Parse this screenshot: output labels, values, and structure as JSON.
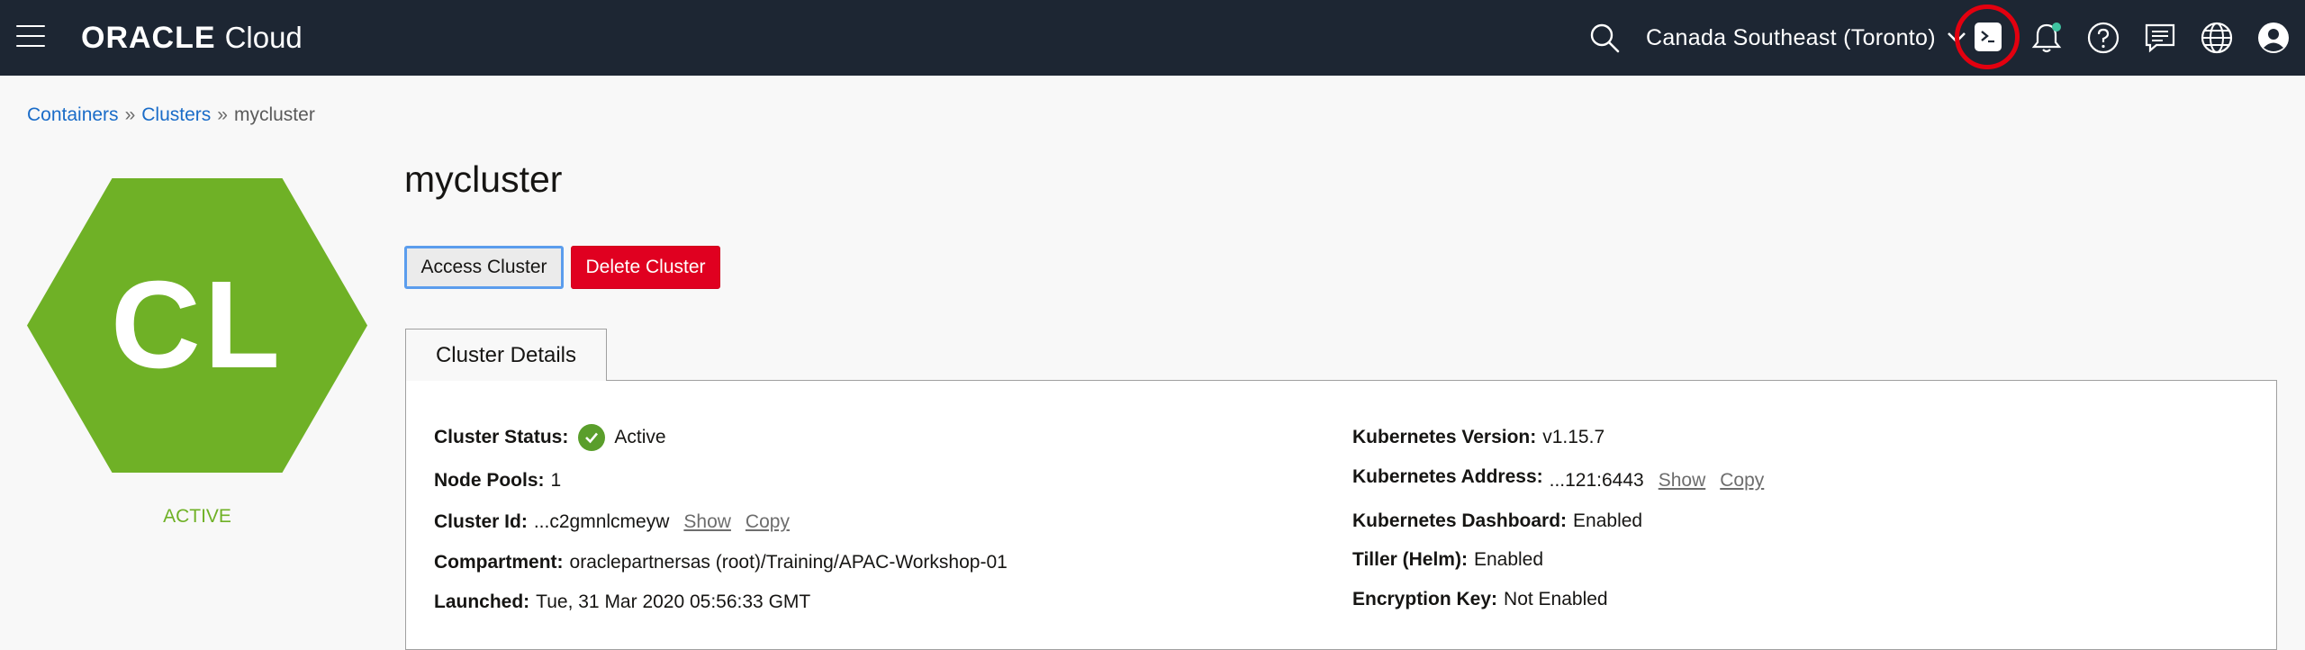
{
  "header": {
    "brand": "ORACLE",
    "product": "Cloud",
    "region": "Canada Southeast (Toronto)",
    "icons": [
      "menu-icon",
      "search-icon",
      "chevron-down-icon",
      "cloud-shell-icon",
      "bell-icon",
      "help-icon",
      "chat-icon",
      "globe-icon",
      "user-icon"
    ],
    "notification_dot_color": "#3fc3a1",
    "bar_color": "#1d2633"
  },
  "breadcrumb": {
    "items": [
      "Containers",
      "Clusters",
      "mycluster"
    ],
    "separator": "»"
  },
  "hexagon": {
    "initials": "CL",
    "status": "ACTIVE",
    "color": "#6fb126"
  },
  "cluster": {
    "name": "mycluster",
    "access_label": "Access Cluster",
    "delete_label": "Delete Cluster",
    "tab_label": "Cluster Details"
  },
  "details": {
    "status_label": "Cluster Status:",
    "status_value": "Active",
    "node_pools_label": "Node Pools:",
    "node_pools_value": "1",
    "cluster_id_label": "Cluster Id:",
    "cluster_id_value": "...c2gmnlcmeyw",
    "compartment_label": "Compartment:",
    "compartment_value": "oraclepartnersas (root)/Training/APAC-Workshop-01",
    "launched_label": "Launched:",
    "launched_value": "Tue, 31 Mar 2020 05:56:33 GMT",
    "k8s_version_label": "Kubernetes Version:",
    "k8s_version_value": "v1.15.7",
    "k8s_address_label": "Kubernetes Address:",
    "k8s_address_value": "...121:6443",
    "k8s_dashboard_label": "Kubernetes Dashboard:",
    "k8s_dashboard_value": "Enabled",
    "tiller_label": "Tiller (Helm):",
    "tiller_value": "Enabled",
    "encryption_label": "Encryption Key:",
    "encryption_value": "Not Enabled",
    "show_label": "Show",
    "copy_label": "Copy"
  }
}
